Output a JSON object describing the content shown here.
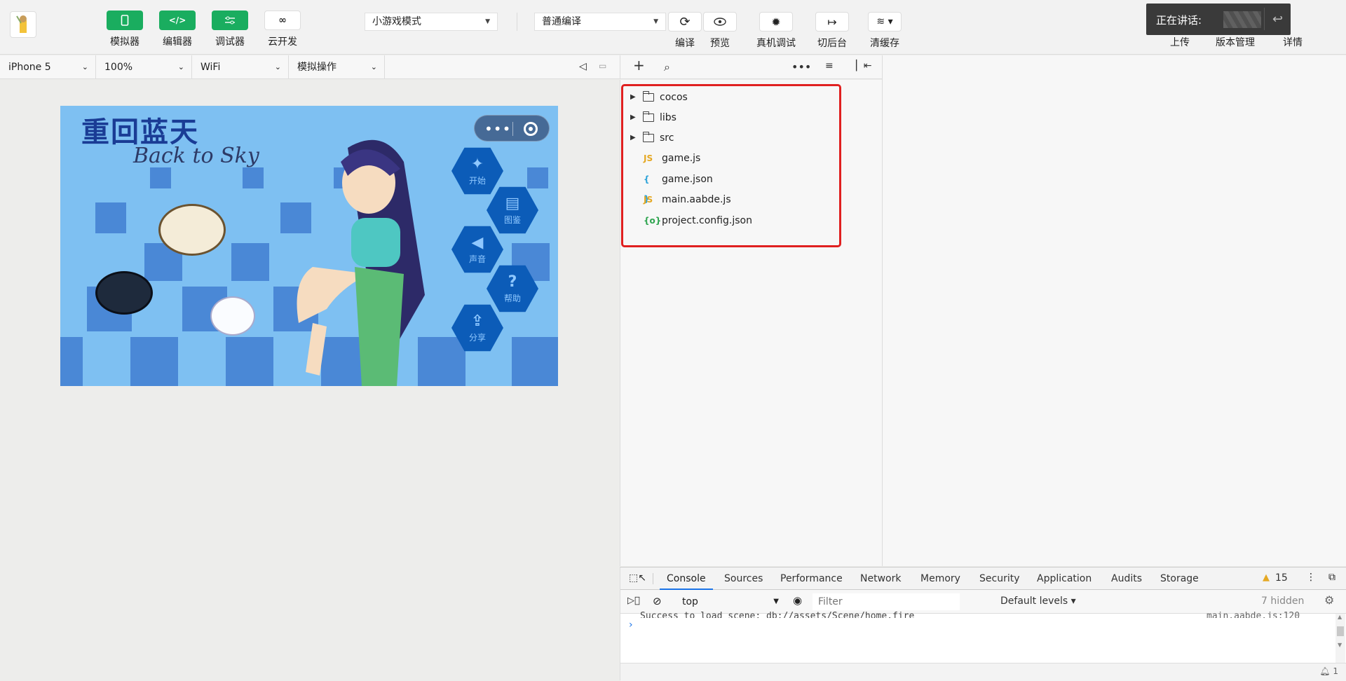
{
  "toolbar": {
    "buttons": [
      {
        "label": "模拟器"
      },
      {
        "label": "编辑器"
      },
      {
        "label": "调试器"
      },
      {
        "label": "云开发"
      }
    ],
    "mode_select": "小游戏模式",
    "compile_select": "普通编译",
    "actions": [
      {
        "label": "编译"
      },
      {
        "label": "预览"
      },
      {
        "label": "真机调试"
      },
      {
        "label": "切后台"
      },
      {
        "label": "清缓存"
      }
    ],
    "speaking_label": "正在讲话:",
    "right": [
      {
        "label": "上传"
      },
      {
        "label": "版本管理"
      },
      {
        "label": "详情"
      }
    ]
  },
  "simulator": {
    "device": "iPhone 5",
    "zoom": "100%",
    "network": "WiFi",
    "operation": "模拟操作"
  },
  "game": {
    "title": "重回蓝天",
    "subtitle": "Back to Sky",
    "menu": [
      {
        "label": "开始"
      },
      {
        "label": "图鉴"
      },
      {
        "label": "声音"
      },
      {
        "label": "帮助"
      },
      {
        "label": "分享"
      }
    ]
  },
  "files": [
    {
      "name": "cocos",
      "type": "folder"
    },
    {
      "name": "libs",
      "type": "folder"
    },
    {
      "name": "src",
      "type": "folder"
    },
    {
      "name": "game.js",
      "type": "js",
      "icon": "JS"
    },
    {
      "name": "game.json",
      "type": "json",
      "icon": "{ }"
    },
    {
      "name": "main.aabde.js",
      "type": "js",
      "icon": "JS"
    },
    {
      "name": "project.config.json",
      "type": "config",
      "icon": "{o}"
    }
  ],
  "devtools": {
    "tabs": [
      "Console",
      "Sources",
      "Performance",
      "Network",
      "Memory",
      "Security",
      "Application",
      "Audits",
      "Storage"
    ],
    "warning_count": "15",
    "context": "top",
    "filter_placeholder": "Filter",
    "levels": "Default levels",
    "hidden": "7 hidden",
    "log_text": "Success to load scene: db://assets/Scene/home.fire",
    "log_source": "main.aabde.js:120",
    "notification_count": "1"
  },
  "colors": {
    "accent_green": "#1aad5f",
    "highlight_red": "#e02020",
    "devtools_blue": "#1a73e8",
    "js_yellow": "#e5a823",
    "json_blue": "#2aa2d8",
    "config_green": "#2ea44f"
  }
}
